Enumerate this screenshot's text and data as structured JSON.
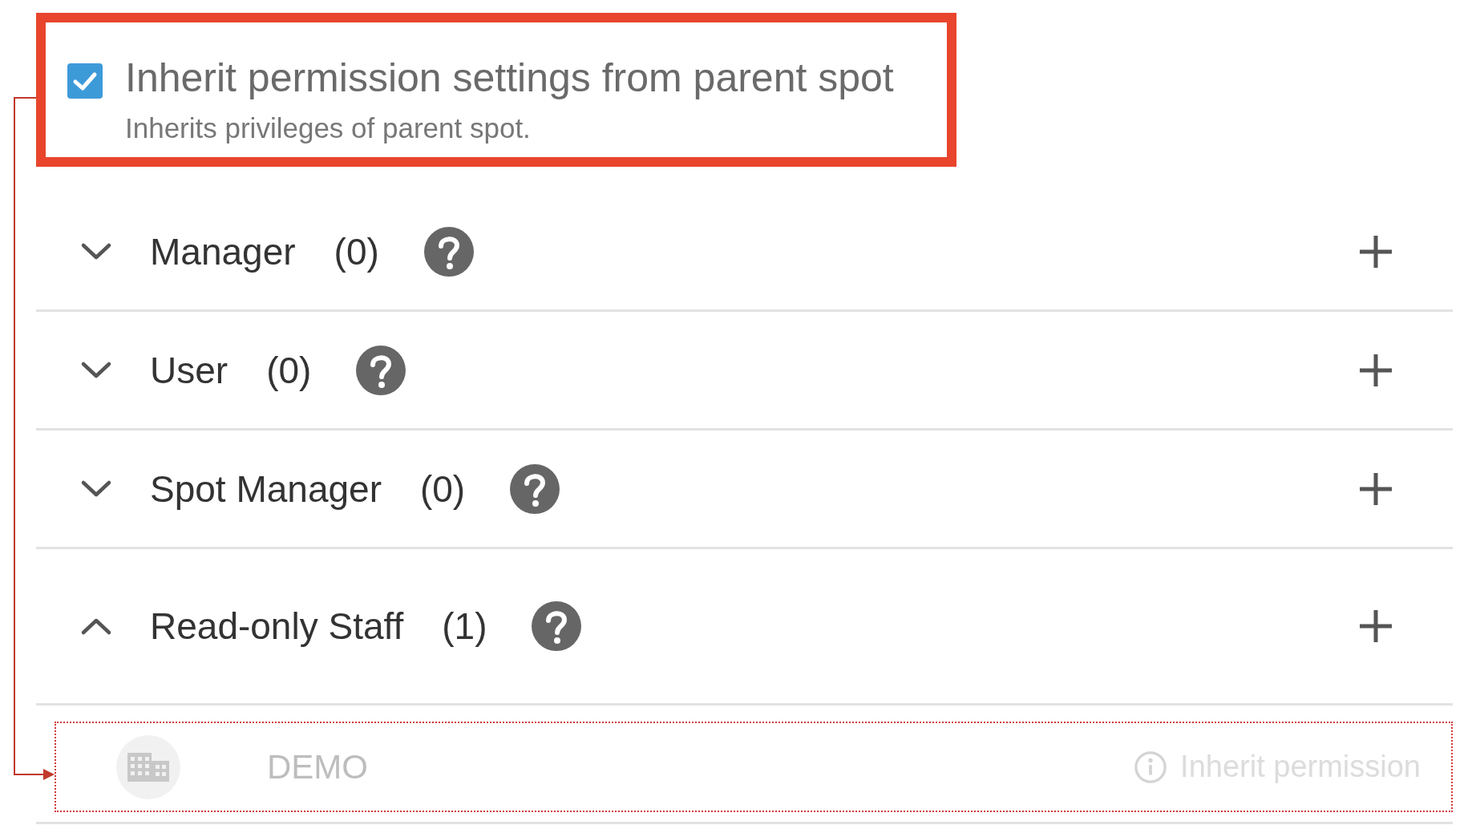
{
  "inherit": {
    "checked": true,
    "title": "Inherit permission settings from parent spot",
    "subtitle": "Inherits privileges of parent spot."
  },
  "roles": [
    {
      "name": "Manager",
      "count": "(0)",
      "expanded": false
    },
    {
      "name": "User",
      "count": "(0)",
      "expanded": false
    },
    {
      "name": "Spot Manager",
      "count": "(0)",
      "expanded": false
    },
    {
      "name": "Read-only Staff",
      "count": "(1)",
      "expanded": true
    }
  ],
  "members": [
    {
      "name": "DEMO",
      "status": "Inherit permission"
    }
  ]
}
